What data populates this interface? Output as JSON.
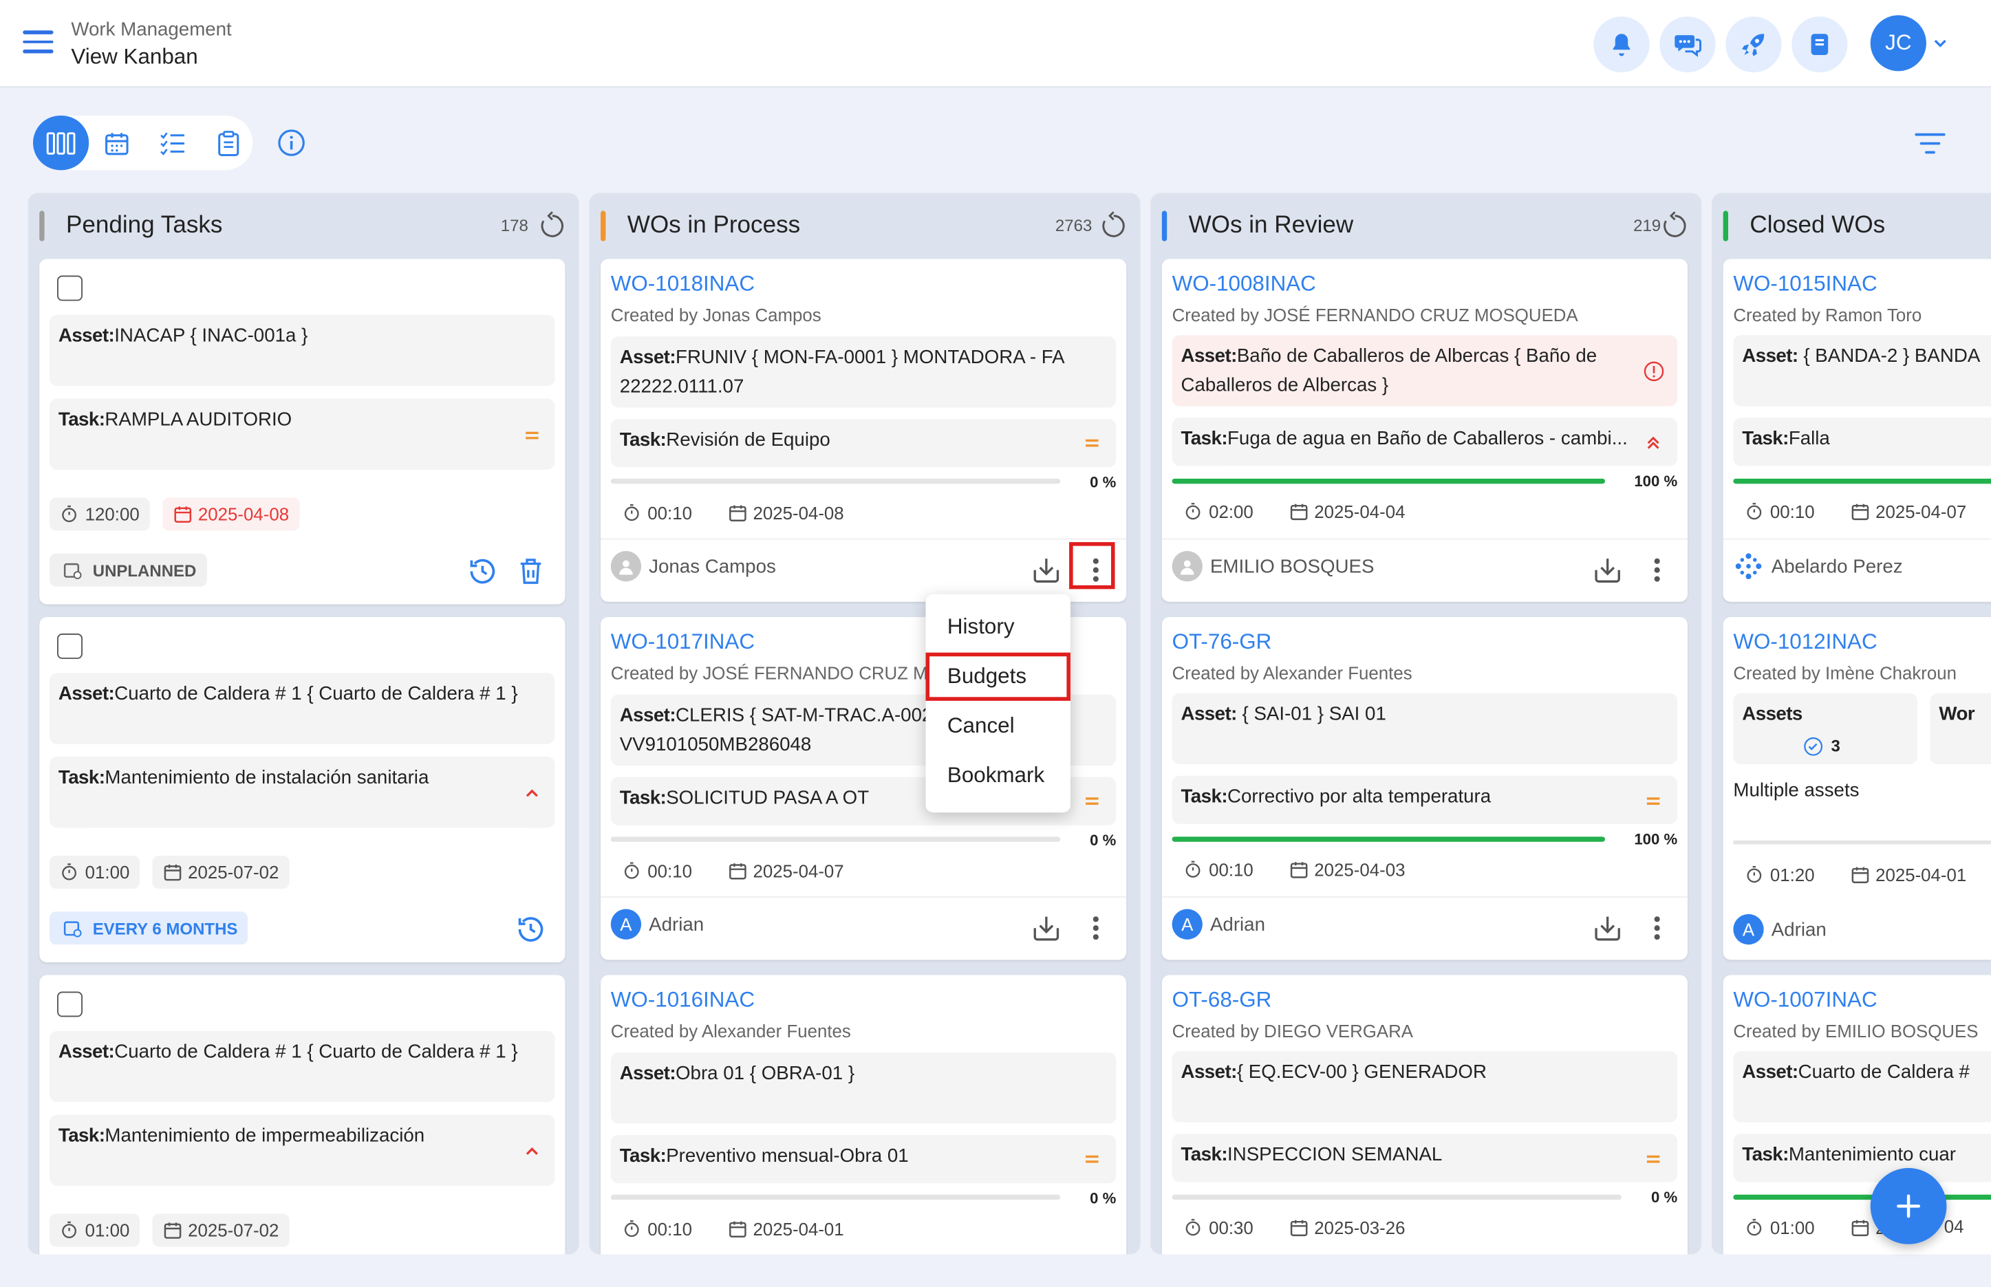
{
  "header": {
    "app_name": "Work Management",
    "page_name": "View Kanban",
    "user_initials": "JC"
  },
  "colors": {
    "accent": "#2f80ed",
    "pending": "#9e9e9e",
    "process": "#f0952f",
    "review": "#2f80ed",
    "closed": "#22b14c",
    "highlight": "#e01e1e"
  },
  "columns": [
    {
      "title": "Pending Tasks",
      "count": "178"
    },
    {
      "title": "WOs in Process",
      "count": "2763"
    },
    {
      "title": "WOs in Review",
      "count": "219"
    },
    {
      "title": "Closed WOs",
      "count": ""
    }
  ],
  "labels": {
    "asset": "Asset:",
    "task": "Task:",
    "assets": "Assets"
  },
  "pending": [
    {
      "asset": "INACAP { INAC-001a }",
      "task": "RAMPLA AUDITORIO",
      "time": "120:00",
      "date": "2025-04-08",
      "badge": "UNPLANNED",
      "priority": "medium"
    },
    {
      "asset": "Cuarto de Caldera # 1 { Cuarto de Caldera # 1 }",
      "task": "Mantenimiento de instalación sanitaria",
      "time": "01:00",
      "date": "2025-07-02",
      "badge": "EVERY 6 MONTHS",
      "priority": "high"
    },
    {
      "asset": "Cuarto de Caldera # 1 { Cuarto de Caldera # 1 }",
      "task": "Mantenimiento de impermeabilización",
      "time": "01:00",
      "date": "2025-07-02",
      "priority": "high"
    }
  ],
  "process": [
    {
      "wo": "WO-1018INAC",
      "created": "Created by Jonas Campos",
      "asset": "FRUNIV { MON-FA-0001 } MONTADORA - FA 22222.0111.07",
      "task": "Revisión de Equipo",
      "progress": 0,
      "pct": "0 %",
      "time": "00:10",
      "date": "2025-04-08",
      "user": "Jonas Campos"
    },
    {
      "wo": "WO-1017INAC",
      "created": "Created by JOSÉ FERNANDO CRUZ MO",
      "asset": "CLERIS { SAT-M-TRAC.A-002 VV9101050MB286048",
      "task": "SOLICITUD PASA A OT",
      "progress": 0,
      "pct": "0 %",
      "time": "00:10",
      "date": "2025-04-07",
      "user": "Adrian",
      "initial": "A"
    },
    {
      "wo": "WO-1016INAC",
      "created": "Created by Alexander Fuentes",
      "asset": "Obra 01 { OBRA-01 }",
      "task": "Preventivo mensual-Obra 01",
      "progress": 0,
      "pct": "0 %",
      "time": "00:10",
      "date": "2025-04-01"
    }
  ],
  "review": [
    {
      "wo": "WO-1008INAC",
      "created": "Created by JOSÉ FERNANDO CRUZ MOSQUEDA",
      "asset": "Baño de Caballeros de Albercas { Baño de Caballeros de Albercas }",
      "task": "Fuga de agua en Baño de Caballeros - cambi...",
      "progress": 100,
      "pct": "100 %",
      "time": "02:00",
      "date": "2025-04-04",
      "user": "EMILIO BOSQUES"
    },
    {
      "wo": "OT-76-GR",
      "created": "Created by Alexander Fuentes",
      "asset": "{ SAI-01 } SAI 01",
      "task": "Correctivo por alta temperatura",
      "progress": 100,
      "pct": "100 %",
      "time": "00:10",
      "date": "2025-04-03",
      "user": "Adrian",
      "initial": "A"
    },
    {
      "wo": "OT-68-GR",
      "created": "Created by DIEGO VERGARA",
      "asset": "{ EQ.ECV-00 } GENERADOR",
      "task": "INSPECCION SEMANAL",
      "progress": 0,
      "pct": "0 %",
      "time": "00:30",
      "date": "2025-03-26"
    }
  ],
  "closed": [
    {
      "wo": "WO-1015INAC",
      "created": "Created by Ramon Toro",
      "asset": "{ BANDA-2 } BANDA",
      "task": "Falla",
      "time": "00:10",
      "date": "2025-04-07",
      "user": "Abelardo Perez"
    },
    {
      "wo": "WO-1012INAC",
      "created": "Created by Imène Chakroun",
      "assets_count": "3",
      "wor_label": "Wor",
      "multiple": "Multiple assets",
      "time": "01:20",
      "date": "2025-04-01",
      "user": "Adrian",
      "initial": "A"
    },
    {
      "wo": "WO-1007INAC",
      "created": "Created by EMILIO BOSQUES",
      "asset": "Cuarto de Caldera #",
      "task": "Mantenimiento cuar",
      "time": "01:00",
      "date": "2",
      "date_tail": "04"
    }
  ],
  "context_menu": [
    "History",
    "Budgets",
    "Cancel",
    "Bookmark"
  ]
}
